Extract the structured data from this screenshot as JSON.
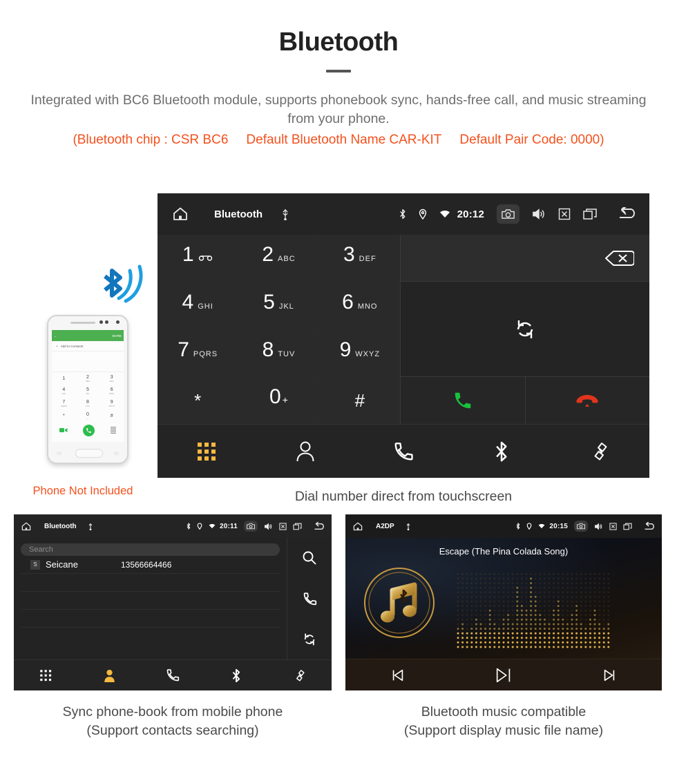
{
  "header": {
    "title": "Bluetooth",
    "intro": "Integrated with BC6 Bluetooth module, supports phonebook sync, hands-free call, and music streaming from your phone.",
    "spec_chip": "(Bluetooth chip : CSR BC6",
    "spec_name": "Default Bluetooth Name CAR-KIT",
    "spec_pair": "Default Pair Code: 0000)",
    "accent_color": "#f4511e",
    "body_color": "#6e6e6e"
  },
  "dialer_panel": {
    "statusbar": {
      "home_icon": "home-icon",
      "title": "Bluetooth",
      "usb_icon": "usb-icon",
      "bluetooth_icon": "bluetooth-icon",
      "location_icon": "location-pin-icon",
      "wifi_icon": "wifi-icon",
      "time": "20:12",
      "camera_icon": "camera-icon",
      "volume_icon": "volume-icon",
      "close_icon": "close-box-icon",
      "recents_icon": "recent-apps-icon",
      "back_icon": "back-arrow-icon"
    },
    "keys": [
      {
        "num": "1",
        "sub": "",
        "icon": "voicemail-icon"
      },
      {
        "num": "2",
        "sub": "ABC",
        "icon": ""
      },
      {
        "num": "3",
        "sub": "DEF",
        "icon": ""
      },
      {
        "num": "4",
        "sub": "GHI",
        "icon": ""
      },
      {
        "num": "5",
        "sub": "JKL",
        "icon": ""
      },
      {
        "num": "6",
        "sub": "MNO",
        "icon": ""
      },
      {
        "num": "7",
        "sub": "PQRS",
        "icon": ""
      },
      {
        "num": "8",
        "sub": "TUV",
        "icon": ""
      },
      {
        "num": "9",
        "sub": "WXYZ",
        "icon": ""
      },
      {
        "num": "*",
        "sub": "",
        "icon": ""
      },
      {
        "num": "0",
        "sub": "",
        "sup": "+",
        "icon": ""
      },
      {
        "num": "#",
        "sub": "",
        "icon": ""
      }
    ],
    "number_display": "",
    "backspace_icon": "backspace-icon",
    "sync_icon": "sync-icon",
    "call_icon": "call-icon",
    "endcall_icon": "end-call-icon",
    "call_color": "#18c23b",
    "endcall_color": "#e0341d",
    "tabs": [
      {
        "name": "dialpad",
        "icon": "dialpad-icon",
        "active": true
      },
      {
        "name": "contacts",
        "icon": "contacts-icon",
        "active": false
      },
      {
        "name": "call-history",
        "icon": "call-history-icon",
        "active": false
      },
      {
        "name": "bluetooth",
        "icon": "bluetooth-icon",
        "active": false
      },
      {
        "name": "disconnect",
        "icon": "link-icon",
        "active": false
      }
    ],
    "active_color": "#f5b942",
    "caption": "Dial number direct from touchscreen"
  },
  "phone_illustration": {
    "appbar_back_icon": "back-arrow-icon",
    "appbar_more": "MORE",
    "add_contact_label": "Add to Contacts",
    "keys": [
      {
        "num": "1",
        "sub": ""
      },
      {
        "num": "2",
        "sub": "ABC"
      },
      {
        "num": "3",
        "sub": "DEF"
      },
      {
        "num": "4",
        "sub": "GHI"
      },
      {
        "num": "5",
        "sub": "JKL"
      },
      {
        "num": "6",
        "sub": "MNO"
      },
      {
        "num": "7",
        "sub": "PQRS"
      },
      {
        "num": "8",
        "sub": "TUV"
      },
      {
        "num": "9",
        "sub": "WXYZ"
      },
      {
        "num": "*",
        "sub": ""
      },
      {
        "num": "0",
        "sub": "+"
      },
      {
        "num": "#",
        "sub": ""
      }
    ],
    "caption": "Phone Not Included",
    "bluetooth_icon": "bluetooth-signal-icon",
    "bluetooth_color": "#1e9fe0"
  },
  "phonebook_panel": {
    "statusbar": {
      "title": "Bluetooth",
      "time": "20:11"
    },
    "search_placeholder": "Search",
    "contacts": [
      {
        "initial": "S",
        "name": "Seicane",
        "number": "13566664466"
      }
    ],
    "side_buttons": [
      {
        "name": "search",
        "icon": "search-icon"
      },
      {
        "name": "call",
        "icon": "call-history-icon"
      },
      {
        "name": "sync",
        "icon": "sync-icon"
      }
    ],
    "tabs": [
      {
        "name": "dialpad",
        "icon": "dialpad-icon",
        "active": false
      },
      {
        "name": "contacts",
        "icon": "contacts-icon",
        "active": true
      },
      {
        "name": "call-history",
        "icon": "call-history-icon",
        "active": false
      },
      {
        "name": "bluetooth",
        "icon": "bluetooth-icon",
        "active": false
      },
      {
        "name": "disconnect",
        "icon": "link-icon",
        "active": false
      }
    ],
    "caption_line1": "Sync phone-book from mobile phone",
    "caption_line2": "(Support contacts searching)"
  },
  "music_panel": {
    "statusbar": {
      "title": "A2DP",
      "time": "20:15"
    },
    "song_title": "Escape (The Pina Colada Song)",
    "album_icon": "bluetooth-music-note-icon",
    "visualizer": "dot-matrix-equalizer",
    "gold_color": "#c79a3e",
    "controls": [
      {
        "name": "previous",
        "icon": "previous-track-icon"
      },
      {
        "name": "play-pause",
        "icon": "play-pause-icon"
      },
      {
        "name": "next",
        "icon": "next-track-icon"
      }
    ],
    "caption_line1": "Bluetooth music compatible",
    "caption_line2": "(Support display music file name)"
  }
}
